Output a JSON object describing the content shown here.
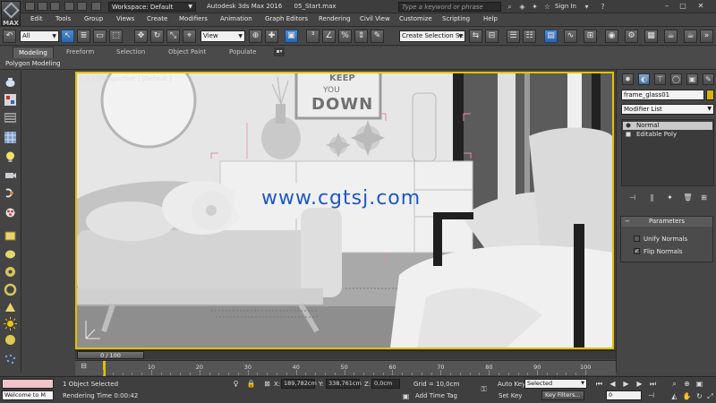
{
  "titlebar": {
    "app_logo": "MAX",
    "workspace_label": "Workspace: Default",
    "document_title": "Autodesk 3ds Max 2016      05_Start.max",
    "search_placeholder": "Type a keyword or phrase",
    "signin": "Sign In"
  },
  "menu": {
    "items": [
      "Edit",
      "Tools",
      "Group",
      "Views",
      "Create",
      "Modifiers",
      "Animation",
      "Graph Editors",
      "Rendering",
      "Civil View",
      "Customize",
      "Scripting",
      "Help"
    ]
  },
  "toolbar": {
    "selection_filter": "All",
    "reference_coord": "View",
    "named_selection": "Create Selection Se"
  },
  "ribbon": {
    "tabs": [
      "Modeling",
      "Freeform",
      "Selection",
      "Object Paint",
      "Populate"
    ],
    "active_tab": "Modeling",
    "panel_label": "Polygon Modeling",
    "options_glyph": "▪▾"
  },
  "viewport": {
    "label": "[ + ] [Perspective ] [Default ]",
    "watermark": "www.cgtsj.com",
    "poster_line1": "KEEP",
    "poster_line2": "YOU",
    "poster_line3": "DOWN",
    "border_color": "#e3c100"
  },
  "command_panel": {
    "object_name": "frame_glass01",
    "object_color": "#d6b30b",
    "modifier_list": "Modifier List",
    "stack": [
      {
        "label": "Normal",
        "selected": true
      },
      {
        "label": "Editable Poly",
        "selected": false
      }
    ],
    "rollout_title": "Parameters",
    "options": [
      {
        "label": "Unify Normals",
        "checked": false
      },
      {
        "label": "Flip Normals",
        "checked": true
      }
    ]
  },
  "timeline": {
    "thumb_label": "0 / 100",
    "ticks": [
      "0",
      "10",
      "20",
      "30",
      "40",
      "50",
      "60",
      "70",
      "80",
      "90",
      "100"
    ],
    "marker_color": "#e3c100"
  },
  "status": {
    "maxscript_text": "Welcome to M",
    "selection_info": "1 Object Selected",
    "render_time": "Rendering Time  0:00:42",
    "x_label": "X:",
    "x_value": "189,782cm",
    "y_label": "Y:",
    "y_value": "338,761cm",
    "z_label": "Z:",
    "z_value": "0,0cm",
    "grid": "Grid = 10,0cm",
    "add_time_tag": "Add Time Tag",
    "auto_key": "Auto Key",
    "set_key": "Set Key",
    "key_mode": "Selected",
    "key_filters": "Key Filters...",
    "frame": "0"
  }
}
